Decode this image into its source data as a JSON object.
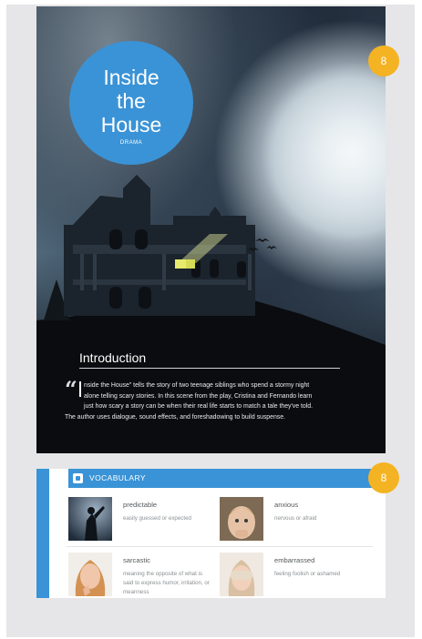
{
  "cover": {
    "title_lines": [
      "Inside",
      "the",
      "House"
    ],
    "genre": "DRAMA",
    "page_badge": "8",
    "intro_heading": "Introduction",
    "quote_mark": "“",
    "intro_lines": [
      "nside the House\" tells the story of two teenage siblings who spend a stormy night",
      "alone telling scary stories. In this scene from the play, Cristina and Fernando learn",
      "just how scary a story can be when their real life starts to match a tale they've told.",
      "The author uses dialogue, sound effects, and foreshadowing to build suspense."
    ]
  },
  "vocabulary": {
    "header": "VOCABULARY",
    "icon": "book-icon",
    "page_badge": "8",
    "words": [
      {
        "term": "predictable",
        "definition": "easily guessed or expected"
      },
      {
        "term": "anxious",
        "definition": "nervous or afraid"
      },
      {
        "term": "sarcastic",
        "definition": "meaning the opposite of what is said to express humor, irritation, or meanness"
      },
      {
        "term": "embarrassed",
        "definition": "feeling foolish or ashamed"
      }
    ]
  },
  "colors": {
    "accent_blue": "#3a93d6",
    "badge_orange": "#f4b323"
  }
}
